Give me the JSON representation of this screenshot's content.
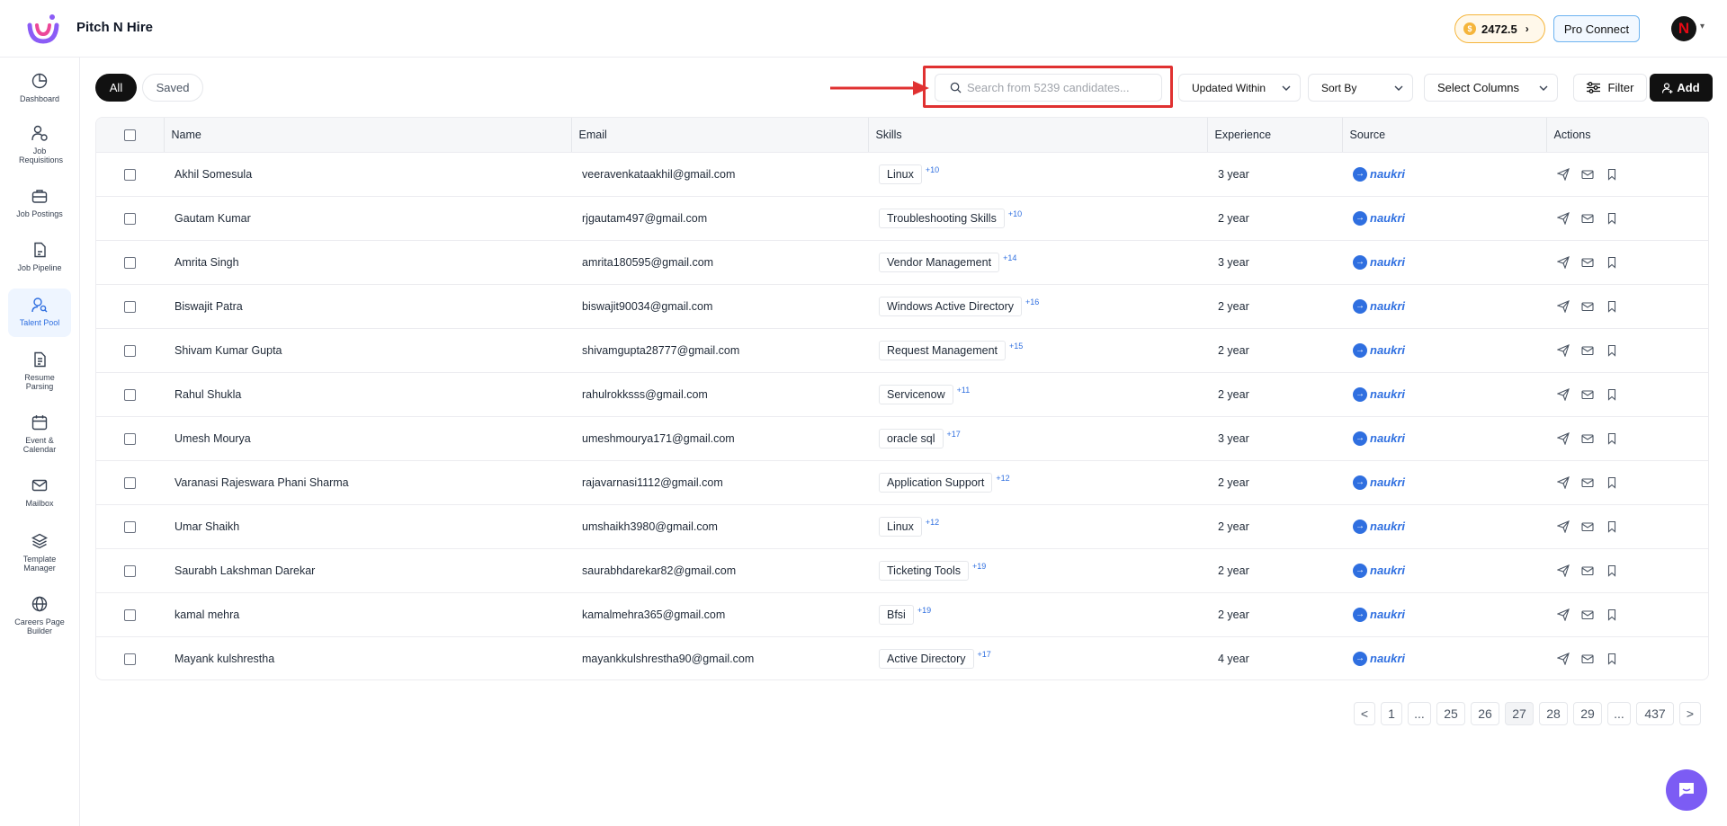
{
  "header": {
    "app_title": "Pitch N Hire",
    "coins": "2472.5",
    "pro_connect": "Pro Connect",
    "avatar_letter": "N"
  },
  "sidebar": {
    "items": [
      {
        "label": "Dashboard",
        "icon": "dashboard-icon"
      },
      {
        "label": "Job Requisitions",
        "icon": "user-plus-icon"
      },
      {
        "label": "Job Postings",
        "icon": "briefcase-icon"
      },
      {
        "label": "Job Pipeline",
        "icon": "document-icon"
      },
      {
        "label": "Talent Pool",
        "icon": "users-search-icon"
      },
      {
        "label": "Resume Parsing",
        "icon": "file-text-icon"
      },
      {
        "label": "Event & Calendar",
        "icon": "calendar-icon"
      },
      {
        "label": "Mailbox",
        "icon": "mail-icon"
      },
      {
        "label": "Template Manager",
        "icon": "layers-icon"
      },
      {
        "label": "Careers Page Builder",
        "icon": "globe-icon"
      }
    ]
  },
  "toolbar": {
    "tab_all": "All",
    "tab_saved": "Saved",
    "search_placeholder": "Search from 5239 candidates...",
    "updated_within": "Updated Within",
    "sort_by": "Sort By",
    "select_columns": "Select Columns",
    "filter": "Filter",
    "add": "Add"
  },
  "table": {
    "headers": [
      "Name",
      "Email",
      "Skills",
      "Experience",
      "Source",
      "Actions"
    ],
    "source_label": "naukri",
    "rows": [
      {
        "name": "Akhil Somesula",
        "email": "veeravenkataakhil@gmail.com",
        "skill": "Linux",
        "more": "+10",
        "experience": "3 year"
      },
      {
        "name": "Gautam Kumar",
        "email": "rjgautam497@gmail.com",
        "skill": "Troubleshooting Skills",
        "more": "+10",
        "experience": "2 year"
      },
      {
        "name": "Amrita Singh",
        "email": "amrita180595@gmail.com",
        "skill": "Vendor Management",
        "more": "+14",
        "experience": "3 year"
      },
      {
        "name": "Biswajit Patra",
        "email": "biswajit90034@gmail.com",
        "skill": "Windows Active Directory",
        "more": "+16",
        "experience": "2 year"
      },
      {
        "name": "Shivam Kumar Gupta",
        "email": "shivamgupta28777@gmail.com",
        "skill": "Request Management",
        "more": "+15",
        "experience": "2 year"
      },
      {
        "name": "Rahul Shukla",
        "email": "rahulrokksss@gmail.com",
        "skill": "Servicenow",
        "more": "+11",
        "experience": "2 year"
      },
      {
        "name": "Umesh Mourya",
        "email": "umeshmourya171@gmail.com",
        "skill": "oracle sql",
        "more": "+17",
        "experience": "3 year"
      },
      {
        "name": "Varanasi Rajeswara Phani Sharma",
        "email": "rajavarnasi1112@gmail.com",
        "skill": "Application Support",
        "more": "+12",
        "experience": "2 year"
      },
      {
        "name": "Umar Shaikh",
        "email": "umshaikh3980@gmail.com",
        "skill": "Linux",
        "more": "+12",
        "experience": "2 year"
      },
      {
        "name": "Saurabh Lakshman Darekar",
        "email": "saurabhdarekar82@gmail.com",
        "skill": "Ticketing Tools",
        "more": "+19",
        "experience": "2 year"
      },
      {
        "name": "kamal mehra",
        "email": "kamalmehra365@gmail.com",
        "skill": "Bfsi",
        "more": "+19",
        "experience": "2 year"
      },
      {
        "name": "Mayank kulshrestha",
        "email": "mayankkulshrestha90@gmail.com",
        "skill": "Active Directory",
        "more": "+17",
        "experience": "4 year"
      }
    ]
  },
  "pagination": {
    "pages": [
      "<",
      "1",
      "...",
      "25",
      "26",
      "27",
      "28",
      "29",
      "...",
      "437",
      ">"
    ],
    "current": "27"
  },
  "colors": {
    "accent": "#2f6fe0",
    "highlight": "#e03131",
    "chat": "#7c5cf4"
  }
}
